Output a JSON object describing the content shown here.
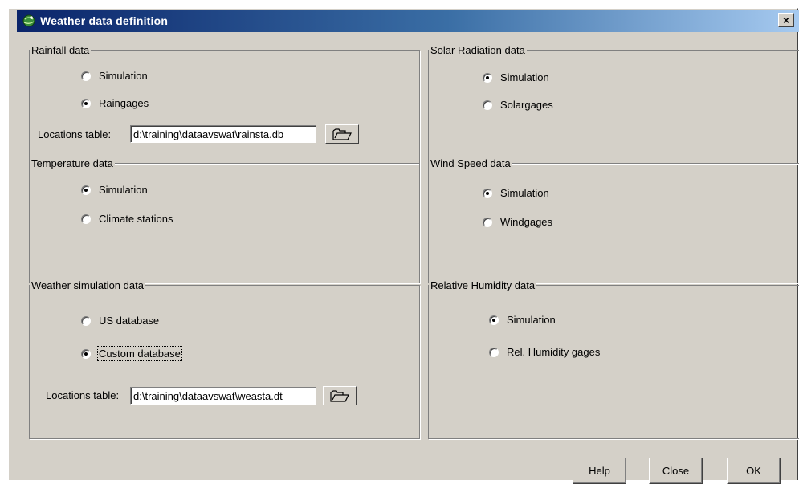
{
  "window": {
    "title": "Weather data definition",
    "close_label": "×"
  },
  "rainfall": {
    "legend": "Rainfall data",
    "options": [
      {
        "label": "Simulation",
        "checked": false
      },
      {
        "label": "Raingages",
        "checked": true
      }
    ],
    "locations_label": "Locations table:",
    "locations_value": "d:\\training\\dataavswat\\rainsta.db"
  },
  "solar": {
    "legend": "Solar Radiation data",
    "options": [
      {
        "label": "Simulation",
        "checked": true
      },
      {
        "label": "Solargages",
        "checked": false
      }
    ]
  },
  "temperature": {
    "legend": "Temperature data",
    "options": [
      {
        "label": "Simulation",
        "checked": true
      },
      {
        "label": "Climate stations",
        "checked": false
      }
    ]
  },
  "wind": {
    "legend": "Wind Speed data",
    "options": [
      {
        "label": "Simulation",
        "checked": true
      },
      {
        "label": "Windgages",
        "checked": false
      }
    ]
  },
  "weather_sim": {
    "legend": "Weather simulation data",
    "options": [
      {
        "label": "US database",
        "checked": false
      },
      {
        "label": "Custom database",
        "checked": true
      }
    ],
    "locations_label": "Locations table:",
    "locations_value": "d:\\training\\dataavswat\\weasta.dt"
  },
  "humidity": {
    "legend": "Relative Humidity data",
    "options": [
      {
        "label": "Simulation",
        "checked": true
      },
      {
        "label": "Rel. Humidity gages",
        "checked": false
      }
    ]
  },
  "buttons": {
    "help": "Help",
    "close": "Close",
    "ok": "OK"
  },
  "icons": {
    "title": "globe-icon",
    "browse": "folder-open-icon"
  }
}
